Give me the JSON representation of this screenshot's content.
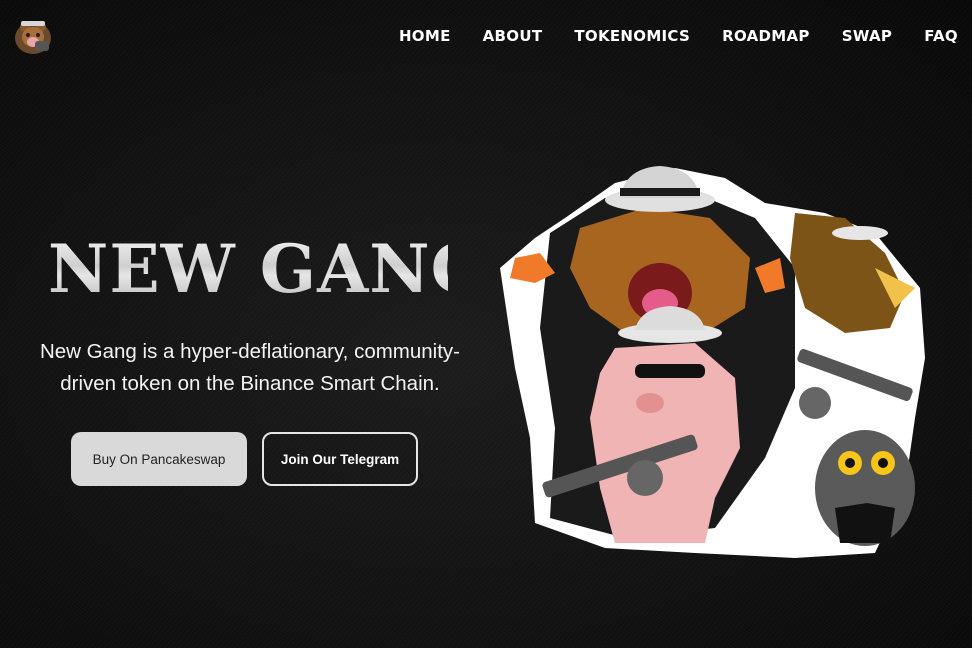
{
  "nav": {
    "items": [
      "HOME",
      "ABOUT",
      "TOKENOMICS",
      "ROADMAP",
      "SWAP",
      "FAQ"
    ]
  },
  "hero": {
    "title": "NEW GANG",
    "subtitle": "New Gang is a hyper-deflationary, community-driven token on the Binance Smart Chain.",
    "buttons": {
      "primary": "Buy On Pancakeswap",
      "secondary": "Join Our Telegram"
    }
  },
  "icons": {
    "logo": "gang-mascot-logo",
    "art": "gang-mascot-illustration"
  },
  "colors": {
    "background": "#0e0e0e",
    "text": "#ffffff",
    "button_primary_bg": "#d9d9d9",
    "button_outline": "#e6e6e6"
  }
}
